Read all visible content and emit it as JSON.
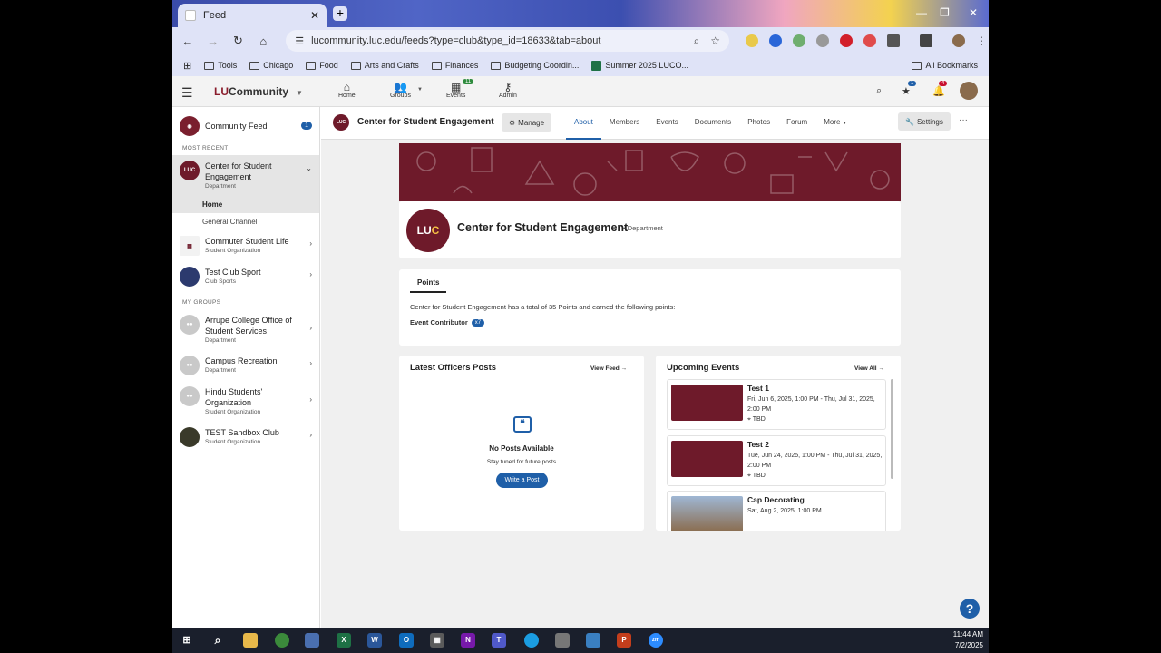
{
  "browser": {
    "tab_title": "Feed",
    "url": "lucommunity.luc.edu/feeds?type=club&type_id=18633&tab=about",
    "bookmarks": [
      "Tools",
      "Chicago",
      "Food",
      "Arts and Crafts",
      "Finances",
      "Budgeting Coordin...",
      "Summer 2025 LUCO..."
    ],
    "all_bookmarks": "All Bookmarks"
  },
  "header": {
    "brand_lu": "LU",
    "brand_rest": "Community",
    "nav": [
      {
        "label": "Home",
        "icon": "home-icon"
      },
      {
        "label": "Groups",
        "icon": "groups-icon"
      },
      {
        "label": "Events",
        "icon": "calendar-icon",
        "badge": "11"
      },
      {
        "label": "Admin",
        "icon": "key-icon"
      }
    ],
    "star_badge": "1",
    "bell_badge": "4"
  },
  "sidebar": {
    "community_feed": "Community Feed",
    "community_feed_badge": "1",
    "most_recent": "MOST RECENT",
    "my_groups": "MY GROUPS",
    "active": {
      "name": "Center for Student Engagement",
      "type": "Department",
      "subitems": [
        "Home",
        "General Channel"
      ]
    },
    "recent": [
      {
        "name": "Commuter Student Life",
        "type": "Student Organization"
      },
      {
        "name": "Test Club Sport",
        "type": "Club Sports"
      }
    ],
    "groups": [
      {
        "name": "Arrupe College Office of Student Services",
        "type": "Department"
      },
      {
        "name": "Campus Recreation",
        "type": "Department"
      },
      {
        "name": "Hindu Students' Organization",
        "type": "Student Organization"
      },
      {
        "name": "TEST Sandbox Club",
        "type": "Student Organization"
      }
    ]
  },
  "subheader": {
    "avatar": "LUC",
    "title": "Center for Student Engagement",
    "manage": "Manage",
    "tabs": [
      "About",
      "Members",
      "Events",
      "Documents",
      "Photos",
      "Forum",
      "More"
    ],
    "settings": "Settings"
  },
  "profile": {
    "logo_lu": "LU",
    "logo_c": "C",
    "name": "Center for Student Engagement",
    "type": "• Department"
  },
  "points": {
    "tab": "Points",
    "summary": "Center for Student Engagement has a total of 35 Points and earned the following points:",
    "badge_name": "Event Contributor",
    "badge_count": "x7"
  },
  "officers": {
    "title": "Latest Officers Posts",
    "view": "View Feed",
    "empty_title": "No Posts Available",
    "empty_sub": "Stay tuned for future posts",
    "write": "Write a Post"
  },
  "events": {
    "title": "Upcoming Events",
    "view": "View All",
    "items": [
      {
        "name": "Test 1",
        "date": "Fri, Jun 6, 2025, 1:00 PM - Thu, Jul 31, 2025, 2:00 PM",
        "loc": "TBD"
      },
      {
        "name": "Test 2",
        "date": "Tue, Jun 24, 2025, 1:00 PM - Thu, Jul 31, 2025, 2:00 PM",
        "loc": "TBD"
      },
      {
        "name": "Cap Decorating",
        "date": "Sat, Aug 2, 2025, 1:00 PM",
        "loc": ""
      }
    ]
  },
  "taskbar": {
    "time": "11:44 AM",
    "date": "7/2/2025"
  }
}
